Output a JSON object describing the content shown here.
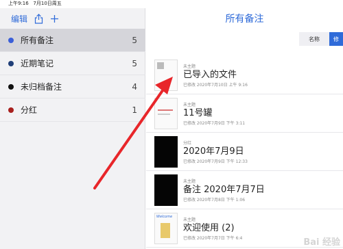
{
  "status": {
    "time": "上午9:16",
    "date": "7月10日周五"
  },
  "sidebar": {
    "edit_label": "编辑",
    "share_icon": "share-icon",
    "add_icon": "plus-icon",
    "folders": [
      {
        "label": "所有备注",
        "count": "5",
        "color": "#3b5fd8"
      },
      {
        "label": "近期笔记",
        "count": "5",
        "color": "#203f78"
      },
      {
        "label": "未归档备注",
        "count": "4",
        "color": "#111111"
      },
      {
        "label": "分红",
        "count": "1",
        "color": "#a8201e"
      }
    ]
  },
  "main": {
    "title": "所有备注",
    "sort": {
      "name_label": "名称",
      "active_label": "修"
    },
    "notes": [
      {
        "folder": "未主题",
        "title": "已导入的文件",
        "meta": "已修改 2020年7月10日 上午 9:16"
      },
      {
        "folder": "未主题",
        "title": "11号罐",
        "meta": "已修改 2020年7月9日 下午 3:11"
      },
      {
        "folder": "分红",
        "title": "2020年7月9日",
        "meta": "已修改 2020年7月9日 下午 12:33"
      },
      {
        "folder": "未主题",
        "title": "备注 2020年7月7日",
        "meta": "已修改 2020年7月8日 下午 1:06"
      },
      {
        "folder": "未主题",
        "title": "欢迎使用 (2)",
        "meta": "已修改 2020年7月7日 下午 6:4",
        "thumb_text": "Welcome"
      }
    ]
  },
  "watermark": "Bai 经验",
  "annotation": {
    "arrow_color": "#e8262a"
  }
}
